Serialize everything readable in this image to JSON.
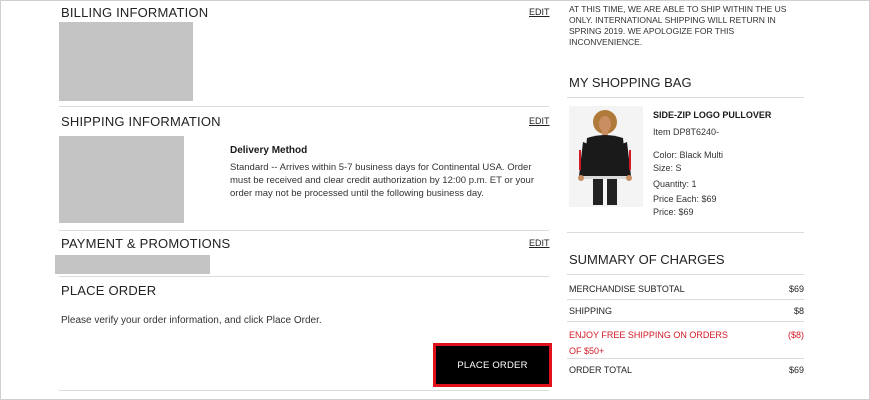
{
  "billing": {
    "title": "BILLING INFORMATION",
    "edit_label": "EDIT"
  },
  "shipping": {
    "title": "SHIPPING INFORMATION",
    "edit_label": "EDIT",
    "delivery_title": "Delivery Method",
    "delivery_text": "Standard -- Arrives within 5-7 business days for Continental USA. Order must be received and clear credit authorization by 12:00 p.m. ET or your order may not be processed until the following business day."
  },
  "payment": {
    "title": "PAYMENT & PROMOTIONS",
    "edit_label": "EDIT"
  },
  "place_order": {
    "title": "PLACE ORDER",
    "instructions": "Please verify your order information, and click Place Order.",
    "button_label": "PLACE ORDER"
  },
  "notice": "AT THIS TIME, WE ARE ABLE TO SHIP WITHIN THE US ONLY. INTERNATIONAL SHIPPING WILL RETURN IN SPRING 2019. WE APOLOGIZE FOR THIS INCONVENIENCE.",
  "bag": {
    "title": "MY SHOPPING BAG",
    "product": {
      "name": "SIDE-ZIP LOGO PULLOVER",
      "item": "Item DP8T6240-",
      "color": "Color: Black Multi",
      "size": "Size: S",
      "quantity": "Quantity: 1",
      "price_each": "Price Each: $69",
      "price": "Price: $69"
    }
  },
  "summary": {
    "title": "SUMMARY OF CHARGES",
    "subtotal_label": "MERCHANDISE SUBTOTAL",
    "subtotal_value": "$69",
    "shipping_label": "SHIPPING",
    "shipping_value": "$8",
    "promo_label": "ENJOY FREE SHIPPING ON ORDERS OF $50+",
    "promo_value": "($8)",
    "total_label": "ORDER TOTAL",
    "total_value": "$69"
  },
  "colors": {
    "accent_red": "#d11a24",
    "button_bg": "#000000",
    "placeholder_gray": "#c4c4c4"
  }
}
